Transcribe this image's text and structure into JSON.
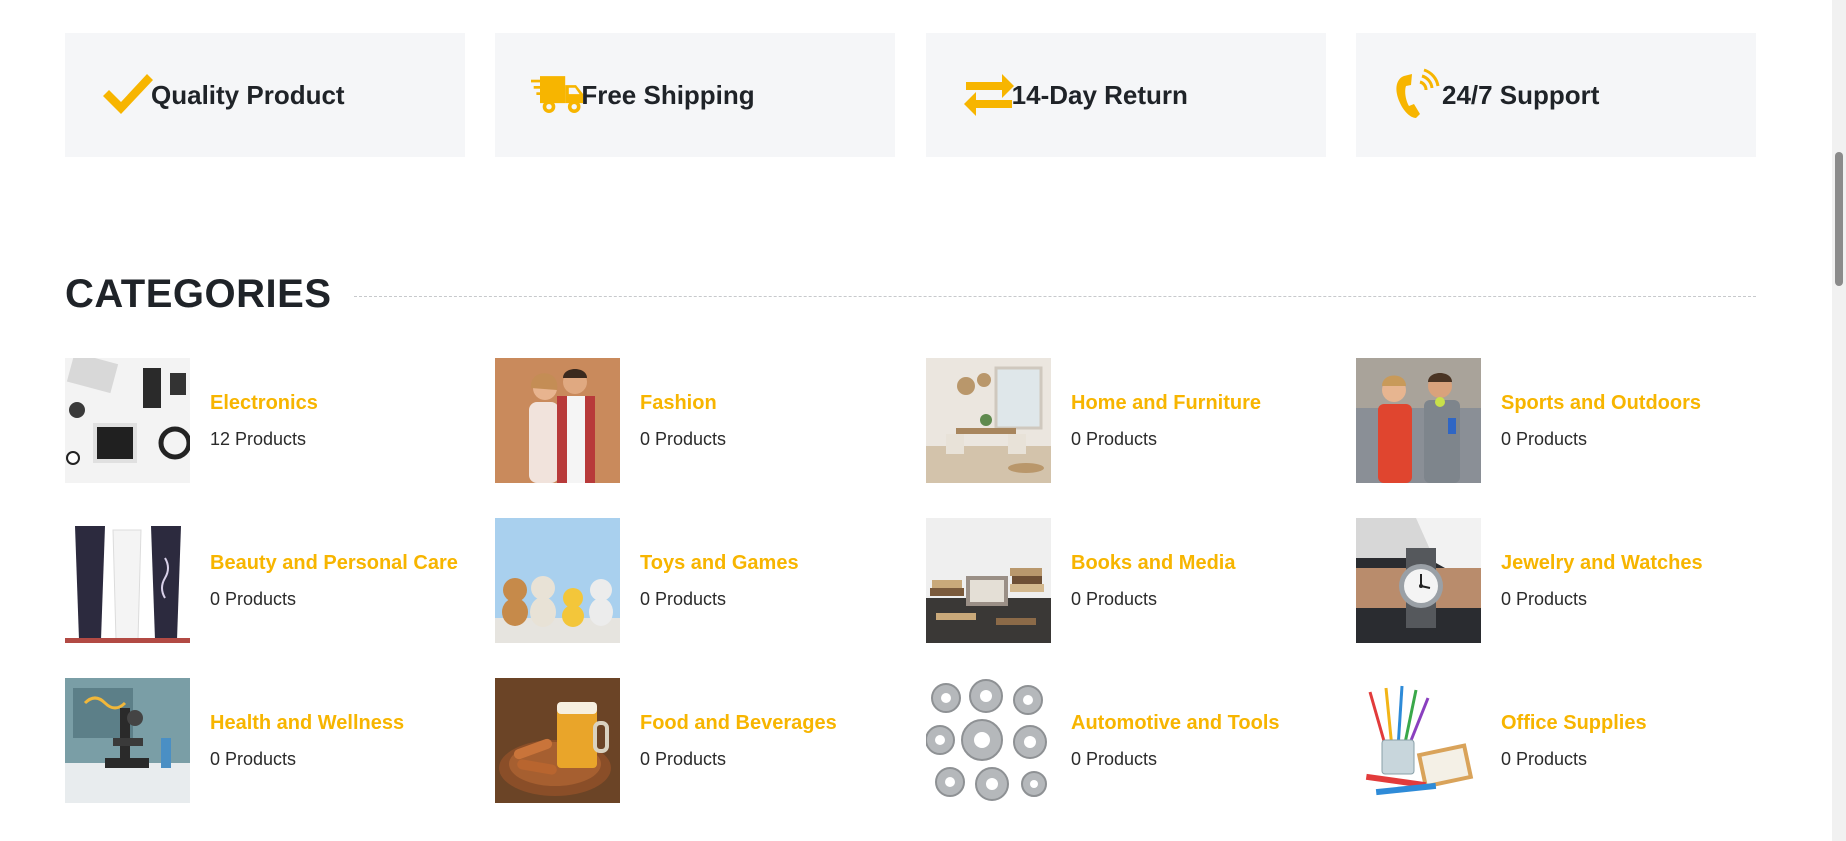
{
  "features": [
    {
      "label": "Quality Product",
      "icon": "checkmark-icon"
    },
    {
      "label": "Free Shipping",
      "icon": "delivery-truck-icon"
    },
    {
      "label": "14-Day Return",
      "icon": "exchange-arrows-icon"
    },
    {
      "label": "24/7 Support",
      "icon": "phone-call-icon"
    }
  ],
  "categories_section": {
    "title": "CATEGORIES"
  },
  "categories": [
    {
      "name": "Electronics",
      "count": "12 Products"
    },
    {
      "name": "Fashion",
      "count": "0 Products"
    },
    {
      "name": "Home and Furniture",
      "count": "0 Products"
    },
    {
      "name": "Sports and Outdoors",
      "count": "0 Products"
    },
    {
      "name": "Beauty and Personal Care",
      "count": "0 Products"
    },
    {
      "name": "Toys and Games",
      "count": "0 Products"
    },
    {
      "name": "Books and Media",
      "count": "0 Products"
    },
    {
      "name": "Jewelry and Watches",
      "count": "0 Products"
    },
    {
      "name": "Health and Wellness",
      "count": "0 Products"
    },
    {
      "name": "Food and Beverages",
      "count": "0 Products"
    },
    {
      "name": "Automotive and Tools",
      "count": "0 Products"
    },
    {
      "name": "Office Supplies",
      "count": "0 Products"
    }
  ],
  "colors": {
    "accent": "#f7b500",
    "feature_bg": "#f5f6f8",
    "text": "#1f2328"
  }
}
